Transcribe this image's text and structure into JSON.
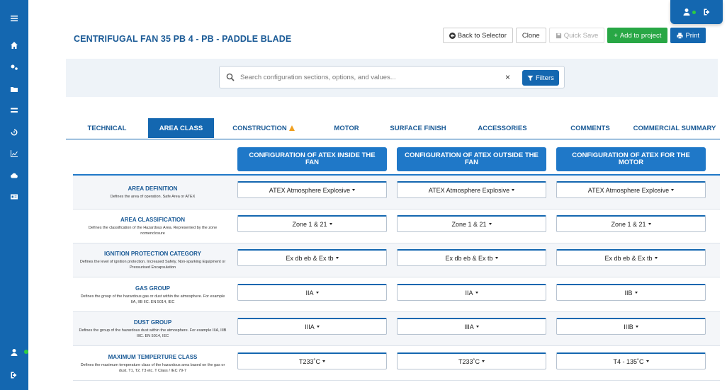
{
  "page_title": "CENTRIFUGAL FAN 35 PB 4 - PB - PADDLE BLADE",
  "actions": {
    "back": "Back to Selector",
    "clone": "Clone",
    "quick_save": "Quick Save",
    "add_to_project": "Add to project",
    "print": "Print"
  },
  "search": {
    "placeholder": "Search configuration sections, options, and values...",
    "clear": "×",
    "filters": "Filters"
  },
  "tabs": [
    {
      "label": "TECHNICAL"
    },
    {
      "label": "AREA CLASS"
    },
    {
      "label": "CONSTRUCTION"
    },
    {
      "label": "MOTOR"
    },
    {
      "label": "SURFACE FINISH"
    },
    {
      "label": "ACCESSORIES"
    },
    {
      "label": "COMMENTS"
    },
    {
      "label": "COMMERCIAL SUMMARY"
    }
  ],
  "columns": [
    "CONFIGURATION OF ATEX INSIDE THE FAN",
    "CONFIGURATION OF ATEX OUTSIDE THE FAN",
    "CONFIGURATION OF ATEX FOR THE MOTOR"
  ],
  "rows": [
    {
      "title": "AREA DEFINITION",
      "desc": "Defines the area of operation. Safe Area or ATEX",
      "values": [
        "ATEX Atmosphere Explosive",
        "ATEX Atmosphere Explosive",
        "ATEX Atmosphere Explosive"
      ]
    },
    {
      "title": "AREA CLASSIFICATION",
      "desc": "Defines the classification of the Hazardous Area. Represented by the zone nomenclosure",
      "values": [
        "Zone 1 & 21",
        "Zone 1 & 21",
        "Zone 1 & 21"
      ]
    },
    {
      "title": "IGNITION PROTECTION CATEGORY",
      "desc": "Defines the level of ignition protection. Increased Safety, Non-sparking Equipment or Pressurised Encapsulation",
      "values": [
        "Ex db eb & Ex tb",
        "Ex db eb & Ex tb",
        "Ex db eb & Ex tb"
      ]
    },
    {
      "title": "GAS GROUP",
      "desc": "Defines the group of the hazardous gas or dust within the atmosphere. For example IIA, IIB IIC. EN 5014, IEC",
      "values": [
        "IIA",
        "IIA",
        "IIB"
      ]
    },
    {
      "title": "DUST GROUP",
      "desc": "Defines the group of the hazardous dust within the atmosphere. For example IIIA, IIIB IIIC. EN 5014, IEC",
      "values": [
        "IIIA",
        "IIIA",
        "IIIB"
      ]
    },
    {
      "title": "MAXIMUM TEMPERTURE CLASS",
      "desc": "Defines the maximum temperature class of the hazardous area based on the gas or dust. T1, T2, T3 etc. T Class / IEC 79-7",
      "values": [
        "T233˚C",
        "T233˚C",
        "T4 - 135˚C"
      ]
    }
  ],
  "colors": {
    "brand": "#1467b0",
    "header": "#1f78c8",
    "green": "#28a745"
  }
}
